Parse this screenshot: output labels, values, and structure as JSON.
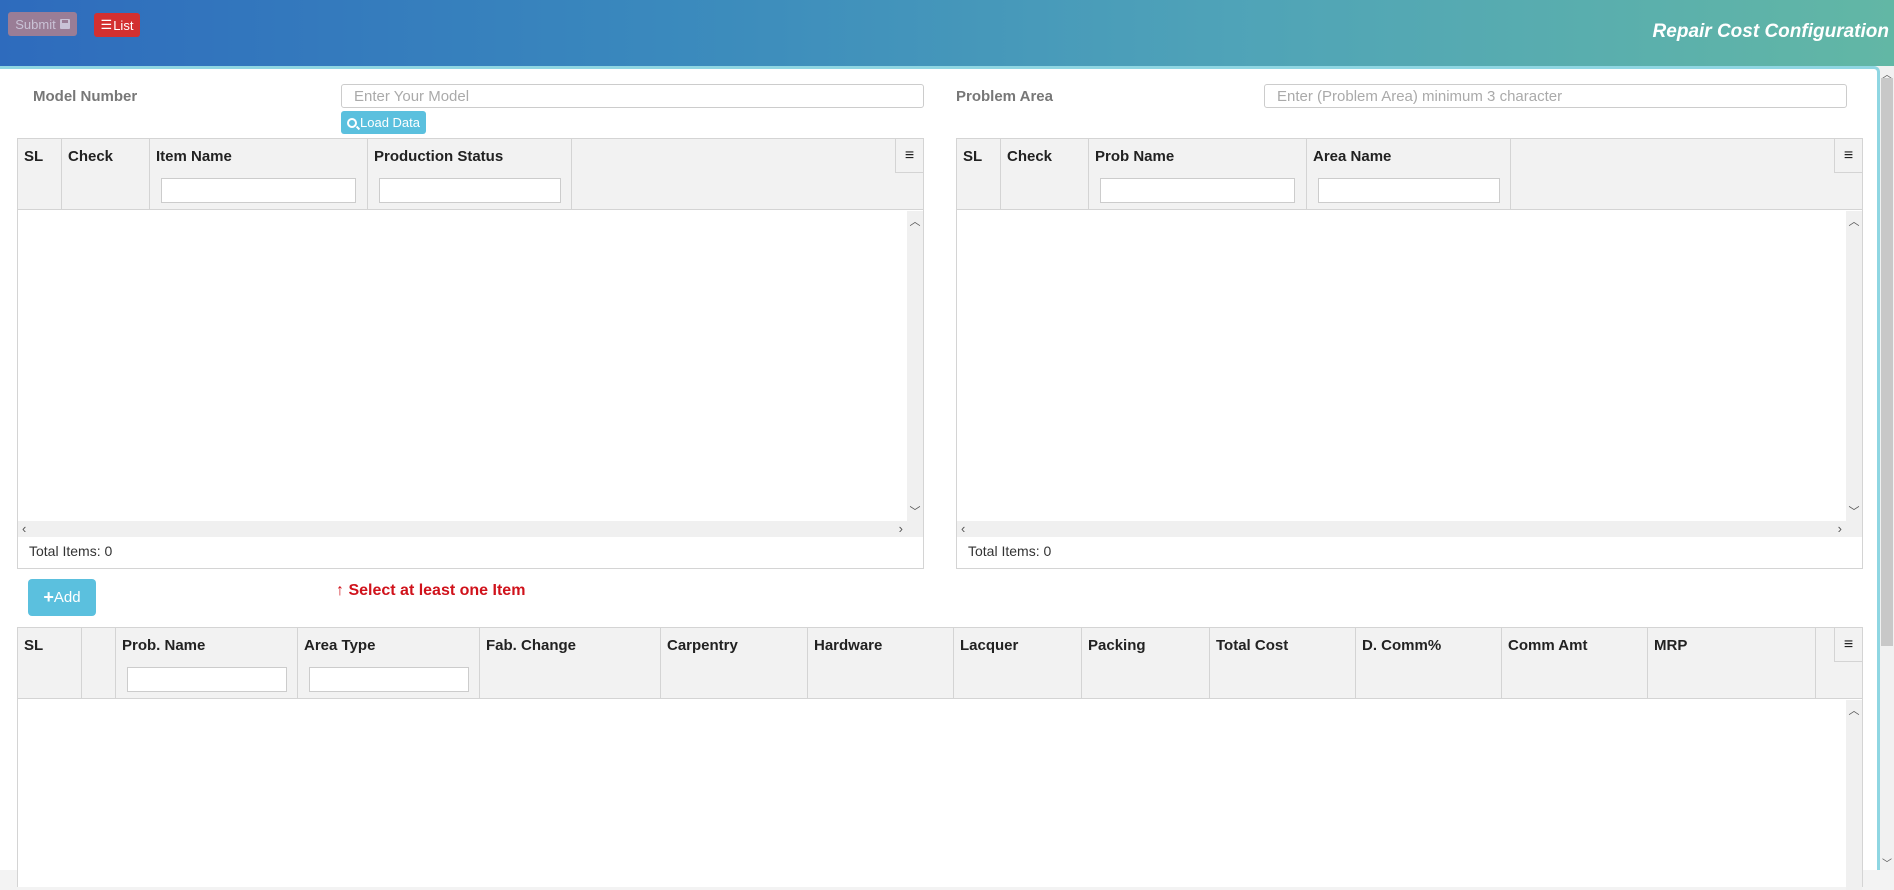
{
  "header": {
    "title": "Repair Cost Configuration",
    "submit_label": "Submit",
    "list_label": "List"
  },
  "icons": {
    "save": "💾",
    "list": "☰",
    "search": "🔍",
    "menu": "≡",
    "plus": "+",
    "arrow_up": "↑"
  },
  "model": {
    "label": "Model Number",
    "placeholder": "Enter Your Model",
    "value": "",
    "load_label": "Load Data"
  },
  "problem": {
    "label": "Problem Area",
    "placeholder": "Enter (Problem Area) minimum 3 character",
    "value": ""
  },
  "item_grid": {
    "columns": [
      {
        "label": "SL",
        "filter": false
      },
      {
        "label": "Check",
        "filter": false
      },
      {
        "label": "Item Name",
        "filter": true
      },
      {
        "label": "Production Status",
        "filter": true
      }
    ],
    "rows": [],
    "footer": "Total Items: 0"
  },
  "problem_grid": {
    "columns": [
      {
        "label": "SL",
        "filter": false
      },
      {
        "label": "Check",
        "filter": false
      },
      {
        "label": "Prob Name",
        "filter": true
      },
      {
        "label": "Area Name",
        "filter": true
      }
    ],
    "rows": [],
    "footer": "Total Items: 0"
  },
  "add": {
    "label": "Add",
    "warning": "Select at least one Item"
  },
  "cost_grid": {
    "columns": [
      {
        "label": "SL",
        "filter": false
      },
      {
        "label": "",
        "filter": false
      },
      {
        "label": "Prob. Name",
        "filter": true
      },
      {
        "label": "Area Type",
        "filter": true
      },
      {
        "label": "Fab. Change",
        "filter": false
      },
      {
        "label": "Carpentry",
        "filter": false
      },
      {
        "label": "Hardware",
        "filter": false
      },
      {
        "label": "Lacquer",
        "filter": false
      },
      {
        "label": "Packing",
        "filter": false
      },
      {
        "label": "Total Cost",
        "filter": false
      },
      {
        "label": "D. Comm%",
        "filter": false
      },
      {
        "label": "Comm Amt",
        "filter": false
      },
      {
        "label": "MRP",
        "filter": false
      }
    ],
    "rows": []
  }
}
